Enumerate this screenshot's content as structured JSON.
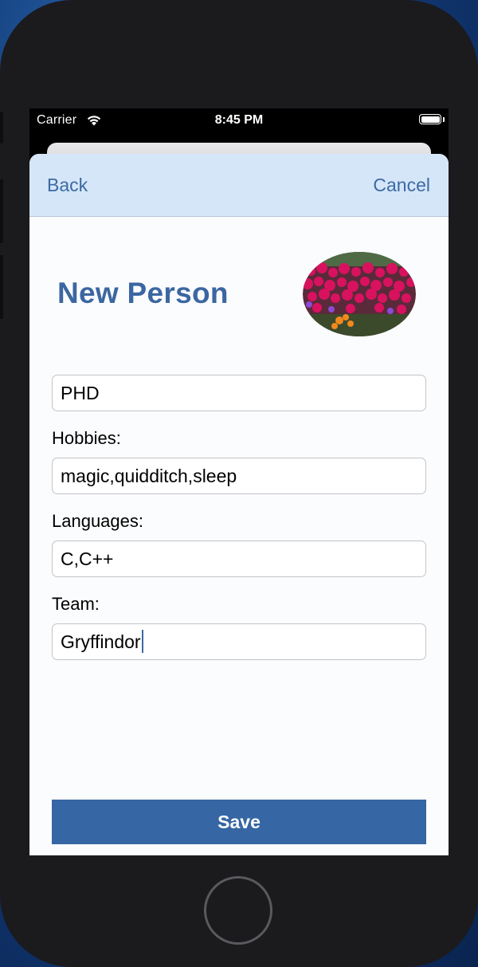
{
  "status_bar": {
    "carrier": "Carrier",
    "time": "8:45 PM",
    "wifi_icon": "wifi-icon",
    "battery_icon": "battery-full-icon"
  },
  "nav": {
    "back_label": "Back",
    "cancel_label": "Cancel"
  },
  "page": {
    "title": "New Person",
    "photo_description_icon": "profile-photo-flowers"
  },
  "form": {
    "degree_value": "PHD",
    "hobbies_label": "Hobbies:",
    "hobbies_value": "magic,quidditch,sleep",
    "languages_label": "Languages:",
    "languages_value": "C,C++",
    "team_label": "Team:",
    "team_value": "Gryffindor"
  },
  "actions": {
    "save_label": "Save"
  },
  "colors": {
    "accent": "#3666a3",
    "nav_background": "#d5e6f8",
    "title": "#3b67a1"
  }
}
